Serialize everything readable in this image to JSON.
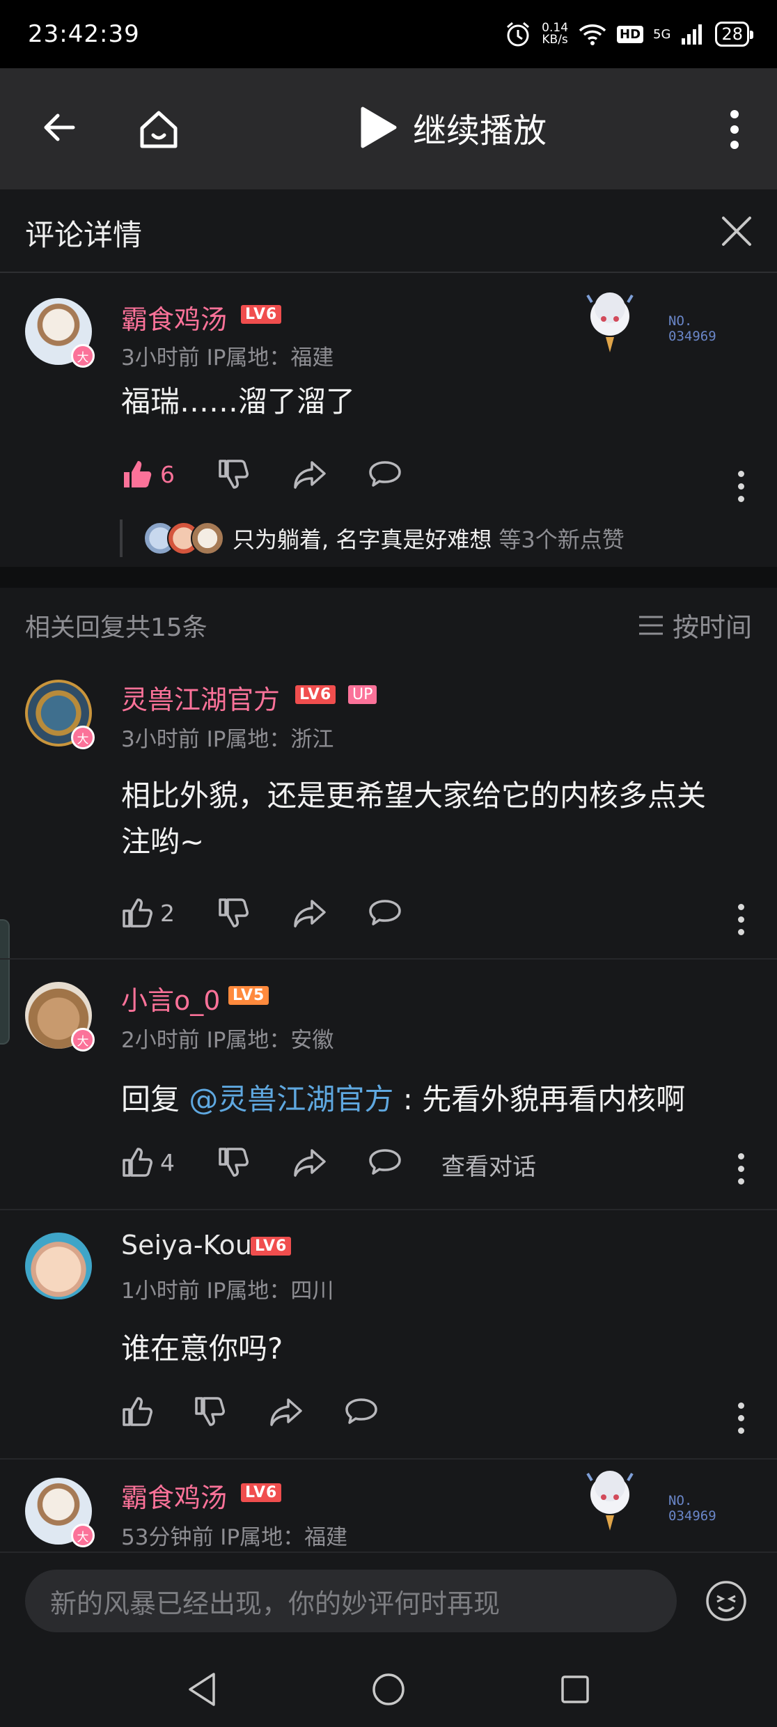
{
  "status_bar": {
    "time": "23:42:39",
    "speed_value": "0.14",
    "speed_unit": "KB/s",
    "hd": "HD",
    "network": "5G",
    "battery": "28"
  },
  "top_bar": {
    "title": "继续播放"
  },
  "panel": {
    "title": "评论详情"
  },
  "main_comment": {
    "username": "霸食鸡汤",
    "level": "LV6",
    "badge": "大",
    "meta": "3小时前 IP属地：福建",
    "fan_no_label": "NO.",
    "fan_no": "034969",
    "content": "福瑞……溜了溜了",
    "likes": "6",
    "likers_names": "只为躺着, 名字真是好难想",
    "likers_suffix": "等3个新点赞"
  },
  "replies_header": {
    "count_text": "相关回复共15条",
    "sort_label": "按时间"
  },
  "replies": [
    {
      "username": "灵兽江湖官方",
      "level": "LV6",
      "up_tag": "UP",
      "badge": "大",
      "meta": "3小时前 IP属地：浙江",
      "content_line1": "相比外貌，还是更希望大家给它的内核多点关",
      "content_line2": "注哟~",
      "likes": "2"
    },
    {
      "username": "小言o_0",
      "level": "LV5",
      "badge": "大",
      "meta": "2小时前 IP属地：安徽",
      "reply_prefix": "回复",
      "mention": "@灵兽江湖官方",
      "content": " : 先看外貌再看内核啊",
      "likes": "4",
      "view_convo": "查看对话"
    },
    {
      "username": "Seiya-Kou",
      "level": "LV6",
      "meta": "1小时前 IP属地：四川",
      "content": "谁在意你吗?"
    },
    {
      "username": "霸食鸡汤",
      "level": "LV6",
      "badge": "大",
      "meta": "53分钟前 IP属地：福建",
      "fan_no_label": "NO.",
      "fan_no": "034969"
    }
  ],
  "input": {
    "placeholder": "新的风暴已经出现，你的妙评何时再现"
  },
  "colors": {
    "accent_pink": "#fb7299",
    "mention_blue": "#5fa8e0",
    "background": "#17181a"
  }
}
